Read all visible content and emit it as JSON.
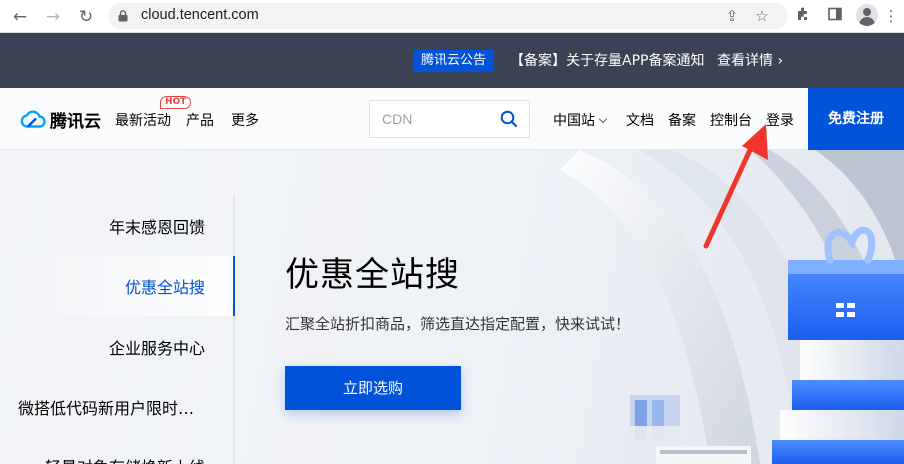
{
  "browser": {
    "url": "cloud.tencent.com"
  },
  "announcement": {
    "badge": "腾讯云公告",
    "text": "【备案】关于存量APP备案通知",
    "more": "查看详情 ›"
  },
  "header": {
    "logo_text": "腾讯云",
    "nav": [
      "最新活动",
      "产品",
      "更多"
    ],
    "hot_badge": "HOT",
    "search_placeholder": "CDN",
    "right_nav": {
      "site": "中国站",
      "docs": "文档",
      "filing": "备案",
      "console": "控制台",
      "login": "登录"
    },
    "register": "免费注册"
  },
  "sidebar": {
    "items": [
      "年末感恩回馈",
      "优惠全站搜",
      "企业服务中心",
      "微搭低代码新用户限时…",
      "轻量对象存储焕新上线"
    ],
    "active_index": 1
  },
  "hero": {
    "title": "优惠全站搜",
    "subtitle": "汇聚全站折扣商品，筛选直达指定配置，快来试试！",
    "button": "立即选购"
  },
  "colors": {
    "brand_blue": "#0052d9",
    "announce_bg": "#3a4254",
    "hot_red": "#e54545",
    "annotation_red": "#f0362c"
  }
}
